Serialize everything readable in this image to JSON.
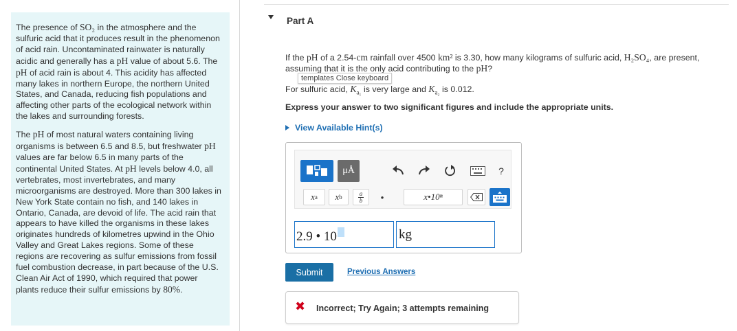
{
  "passage": {
    "p1": {
      "t1": "The presence of ",
      "so2": "SO₂",
      "t2": " in the atmosphere and the sulfuric acid that it produces result in the phenomenon of acid rain. Uncontaminated rainwater is naturally acidic and generally has a ",
      "ph1": "pH",
      "t3": " value of about 5.6. The ",
      "ph2": "pH",
      "t4": " of acid rain is about 4. This acidity has affected  many lakes in northern Europe, the northern United States, and Canada, reducing fish populations and affecting other parts of the ecological network within the lakes and surrounding forests."
    },
    "p2": {
      "t1": "The ",
      "ph1": "pH",
      "t2": " of most natural waters containing living organisms is between 6.5 and 8.5, but freshwater ",
      "ph2": "pH",
      "t3": " values are far below 6.5 in  many parts of the continental United States. At ",
      "ph3": "pH",
      "t4": " levels below 4.0, all vertebrates,  most invertebrates, and many microorganisms are destroyed. More than 300 lakes in New York State contain no fish, and 140 lakes in Ontario, Canada, are devoid of life. The acid rain that appears to have killed the organisms in these lakes originates hundreds of kilometres upwind in the Ohio Valley and Great  Lakes regions. Some of these regions are recovering as sulfur emissions from  fossil fuel combustion decrease, in part because of the U.S. Clean Air Act of 1990, which required that power plants reduce their sulfur emissions by ",
      "pct": "80%",
      "t5": "."
    }
  },
  "part": {
    "title": "Part A"
  },
  "question": {
    "t1": "If the ",
    "ph1": "pH",
    "t2": " of a 2.54-",
    "cm": "cm",
    "t3": " rainfall over 4500 ",
    "km2": "km²",
    "t4": " is 3.30, how  many kilograms of sulfuric acid, ",
    "h2so4": "H₂SO₄",
    "t5": ", are present, assuming that it is the only acid contributing to the ",
    "ph2": "pH",
    "t6": "?"
  },
  "tooltip": "templates Close keyboard",
  "acid_note": {
    "t1": "For sulfuric acid, ",
    "ka1": "K",
    "ka1_sub": "a₁",
    "t2": " is very large and ",
    "ka2": "K",
    "ka2_sub": "a₂",
    "t3": " is 0.012."
  },
  "instructions": "Express your answer to two significant figures and include the appropriate units.",
  "hint_link": "View Available Hint(s)",
  "toolbar": {
    "units_label": "μÅ",
    "undo_icon": "undo-icon",
    "redo_icon": "redo-icon",
    "reset_icon": "reset-icon",
    "keyboard_icon": "keyboard-icon",
    "help_label": "?",
    "superscript_base": "x",
    "superscript_exp": "a",
    "subscript_base": "x",
    "subscript_sub": "b",
    "fraction_num": "a",
    "fraction_den": "b",
    "dot_label": "•",
    "sci_label": "x•10ⁿ"
  },
  "answer": {
    "value": "2.9 • 10",
    "unit": "kg"
  },
  "submit_label": "Submit",
  "previous_answers_label": "Previous Answers",
  "feedback": {
    "icon": "✖",
    "text": "Incorrect; Try Again; 3 attempts remaining"
  },
  "colors": {
    "passage_bg": "#e6f6f8",
    "accent_blue": "#1a73c9",
    "submit_blue": "#1a6fa5",
    "link_blue": "#1f6fb3",
    "error_red": "#d0021b"
  }
}
